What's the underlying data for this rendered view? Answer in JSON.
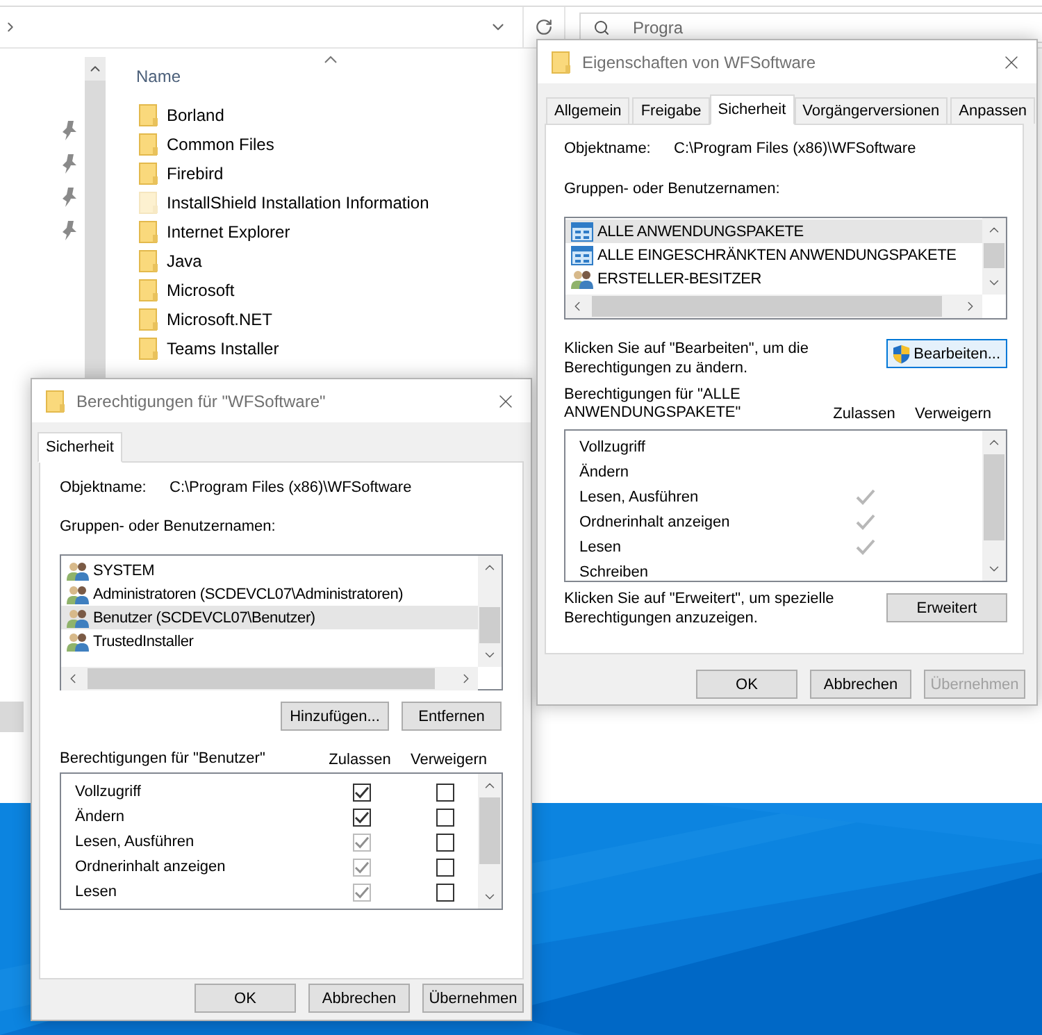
{
  "explorer": {
    "search": {
      "placeholder": "Progra"
    },
    "column_header": "Name",
    "files": [
      {
        "name": "Borland",
        "hidden": false,
        "selected": false
      },
      {
        "name": "Common Files",
        "hidden": false,
        "selected": false
      },
      {
        "name": "Firebird",
        "hidden": false,
        "selected": false
      },
      {
        "name": "InstallShield Installation Information",
        "hidden": true,
        "selected": false
      },
      {
        "name": "Internet Explorer",
        "hidden": false,
        "selected": false
      },
      {
        "name": "Java",
        "hidden": false,
        "selected": false
      },
      {
        "name": "Microsoft",
        "hidden": false,
        "selected": false
      },
      {
        "name": "Microsoft.NET",
        "hidden": false,
        "selected": false
      },
      {
        "name": "Teams Installer",
        "hidden": false,
        "selected": false
      }
    ]
  },
  "properties_dialog": {
    "title": "Eigenschaften von WFSoftware",
    "tabs": [
      {
        "label": "Allgemein",
        "selected": false
      },
      {
        "label": "Freigabe",
        "selected": false
      },
      {
        "label": "Sicherheit",
        "selected": true
      },
      {
        "label": "Vorgängerversionen",
        "selected": false
      },
      {
        "label": "Anpassen",
        "selected": false
      }
    ],
    "object_label": "Objektname:",
    "object_value": "C:\\Program Files (x86)\\WFSoftware",
    "groups_label": "Gruppen- oder Benutzernamen:",
    "groups": [
      {
        "name": "ALLE ANWENDUNGSPAKETE",
        "kind": "package",
        "selected": true
      },
      {
        "name": "ALLE EINGESCHRÄNKTEN ANWENDUNGSPAKETE",
        "kind": "package",
        "selected": false
      },
      {
        "name": "ERSTELLER-BESITZER",
        "kind": "users",
        "selected": false
      }
    ],
    "edit_hint": "Klicken Sie auf \"Bearbeiten\", um die Berechtigungen zu ändern.",
    "edit_button": {
      "label": "Bearbeiten...",
      "focused": true
    },
    "permissions_label": "Berechtigungen für \"ALLE ANWENDUNGSPAKETE\"",
    "allow_header": "Zulassen",
    "deny_header": "Verweigern",
    "permissions": [
      {
        "name": "Vollzugriff",
        "allow": false,
        "deny": false
      },
      {
        "name": "Ändern",
        "allow": false,
        "deny": false
      },
      {
        "name": "Lesen, Ausführen",
        "allow": true,
        "deny": false
      },
      {
        "name": "Ordnerinhalt anzeigen",
        "allow": true,
        "deny": false
      },
      {
        "name": "Lesen",
        "allow": true,
        "deny": false
      },
      {
        "name": "Schreiben",
        "allow": false,
        "deny": false
      }
    ],
    "advanced_hint": "Klicken Sie auf \"Erweitert\", um spezielle Berechtigungen anzuzeigen.",
    "advanced_button": "Erweitert",
    "buttons": [
      {
        "label": "OK",
        "disabled": false
      },
      {
        "label": "Abbrechen",
        "disabled": false
      },
      {
        "label": "Übernehmen",
        "disabled": true
      }
    ]
  },
  "permissions_dialog": {
    "title": "Berechtigungen für \"WFSoftware\"",
    "tabs": [
      {
        "label": "Sicherheit",
        "selected": true
      }
    ],
    "object_label": "Objektname:",
    "object_value": "C:\\Program Files (x86)\\WFSoftware",
    "groups_label": "Gruppen- oder Benutzernamen:",
    "groups": [
      {
        "name": "SYSTEM",
        "kind": "users",
        "selected": false
      },
      {
        "name": "Administratoren (SCDEVCL07\\Administratoren)",
        "kind": "users",
        "selected": false
      },
      {
        "name": "Benutzer (SCDEVCL07\\Benutzer)",
        "kind": "users",
        "selected": true
      },
      {
        "name": "TrustedInstaller",
        "kind": "users",
        "selected": false
      }
    ],
    "add_button": "Hinzufügen...",
    "remove_button": "Entfernen",
    "permissions_label": "Berechtigungen für \"Benutzer\"",
    "allow_header": "Zulassen",
    "deny_header": "Verweigern",
    "permissions": [
      {
        "name": "Vollzugriff",
        "allow": true,
        "allow_disabled": false,
        "deny": false
      },
      {
        "name": "Ändern",
        "allow": true,
        "allow_disabled": false,
        "deny": false
      },
      {
        "name": "Lesen, Ausführen",
        "allow": true,
        "allow_disabled": true,
        "deny": false
      },
      {
        "name": "Ordnerinhalt anzeigen",
        "allow": true,
        "allow_disabled": true,
        "deny": false
      },
      {
        "name": "Lesen",
        "allow": true,
        "allow_disabled": true,
        "deny": false
      }
    ],
    "buttons": [
      {
        "label": "OK",
        "disabled": false
      },
      {
        "label": "Abbrechen",
        "disabled": false
      },
      {
        "label": "Übernehmen",
        "disabled": false
      }
    ]
  }
}
